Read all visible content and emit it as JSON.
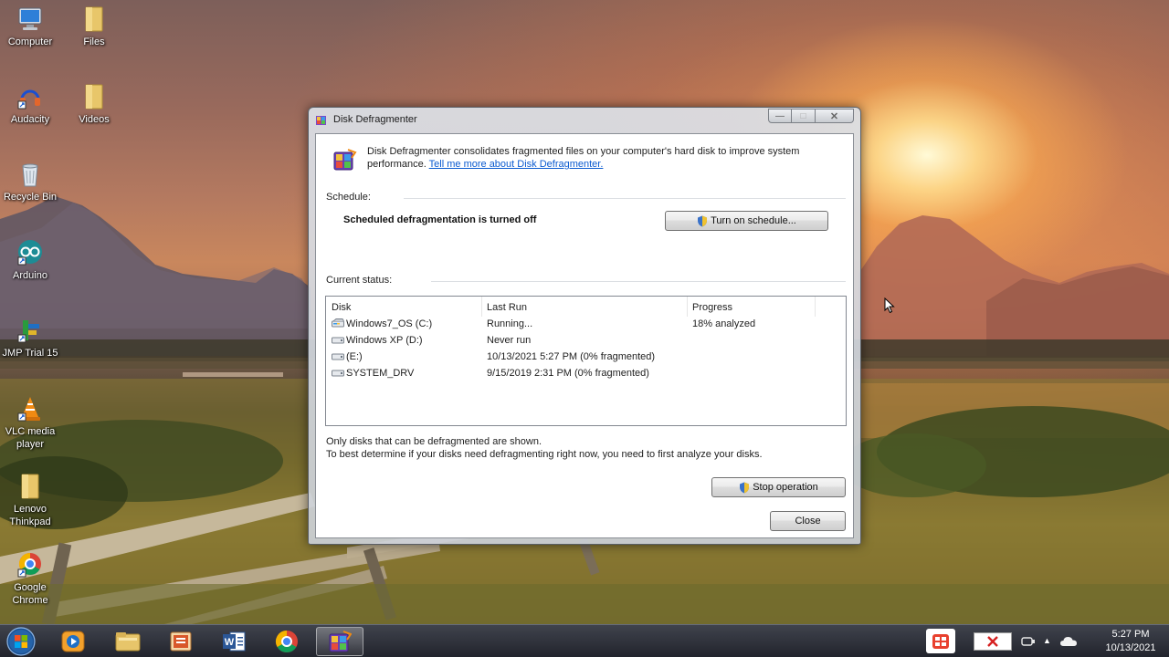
{
  "desktop": {
    "icons": [
      {
        "label": "Computer"
      },
      {
        "label": "Files"
      },
      {
        "label": "Audacity"
      },
      {
        "label": "Videos"
      },
      {
        "label": "Recycle Bin"
      },
      {
        "label": "Arduino"
      },
      {
        "label": "JMP Trial 15"
      },
      {
        "label": "VLC media player"
      },
      {
        "label": "Lenovo Thinkpad"
      },
      {
        "label": "Google Chrome"
      }
    ]
  },
  "window": {
    "title": "Disk Defragmenter",
    "intro_text": "Disk Defragmenter consolidates fragmented files on your computer's hard disk to improve system performance.",
    "intro_link": "Tell me more about Disk Defragmenter.",
    "schedule_label": "Schedule:",
    "schedule_status": "Scheduled defragmentation is turned off",
    "turn_on_button": "Turn on schedule...",
    "current_status_label": "Current status:",
    "columns": {
      "disk": "Disk",
      "last_run": "Last Run",
      "progress": "Progress"
    },
    "disks": [
      {
        "disk": "Windows7_OS (C:)",
        "last_run": "Running...",
        "progress": "18% analyzed"
      },
      {
        "disk": "Windows XP (D:)",
        "last_run": "Never run",
        "progress": ""
      },
      {
        "disk": "(E:)",
        "last_run": "10/13/2021 5:27 PM (0% fragmented)",
        "progress": ""
      },
      {
        "disk": "SYSTEM_DRV",
        "last_run": "9/15/2019 2:31 PM (0% fragmented)",
        "progress": ""
      }
    ],
    "note_line1": "Only disks that can be defragmented are shown.",
    "note_line2": "To best determine if your disks need defragmenting right now, you need to first analyze your disks.",
    "stop_button": "Stop operation",
    "close_button": "Close"
  },
  "taskbar": {
    "items": [
      "windows-media-player",
      "windows-explorer",
      "office-app",
      "microsoft-word",
      "google-chrome",
      "disk-defragmenter"
    ],
    "clock_time": "5:27 PM",
    "clock_date": "10/13/2021"
  },
  "colors": {
    "link": "#0b5bd0",
    "taskbar": "#2a2f3a"
  }
}
